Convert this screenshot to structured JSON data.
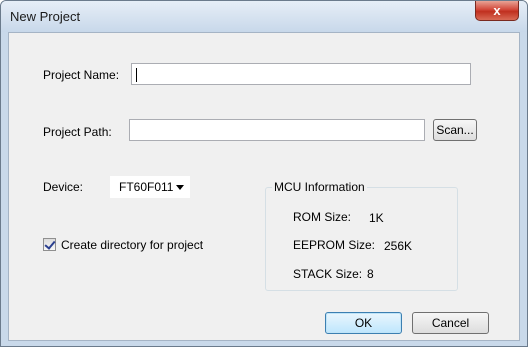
{
  "window": {
    "title": "New Project",
    "close_label": "x"
  },
  "form": {
    "project_name_label": "Project Name:",
    "project_name_value": "",
    "project_path_label": "Project Path:",
    "project_path_value": "",
    "scan_label": "Scan...",
    "device_label": "Device:",
    "device_value": "FT60F011",
    "create_dir_label": "Create directory for project",
    "create_dir_checked": true
  },
  "mcu_info": {
    "title": "MCU Information",
    "rom_label": "ROM Size:",
    "rom_value": "1K",
    "eeprom_label": "EEPROM Size:",
    "eeprom_value": "256K",
    "stack_label": "STACK Size:",
    "stack_value": "8"
  },
  "buttons": {
    "ok_label": "OK",
    "cancel_label": "Cancel"
  }
}
